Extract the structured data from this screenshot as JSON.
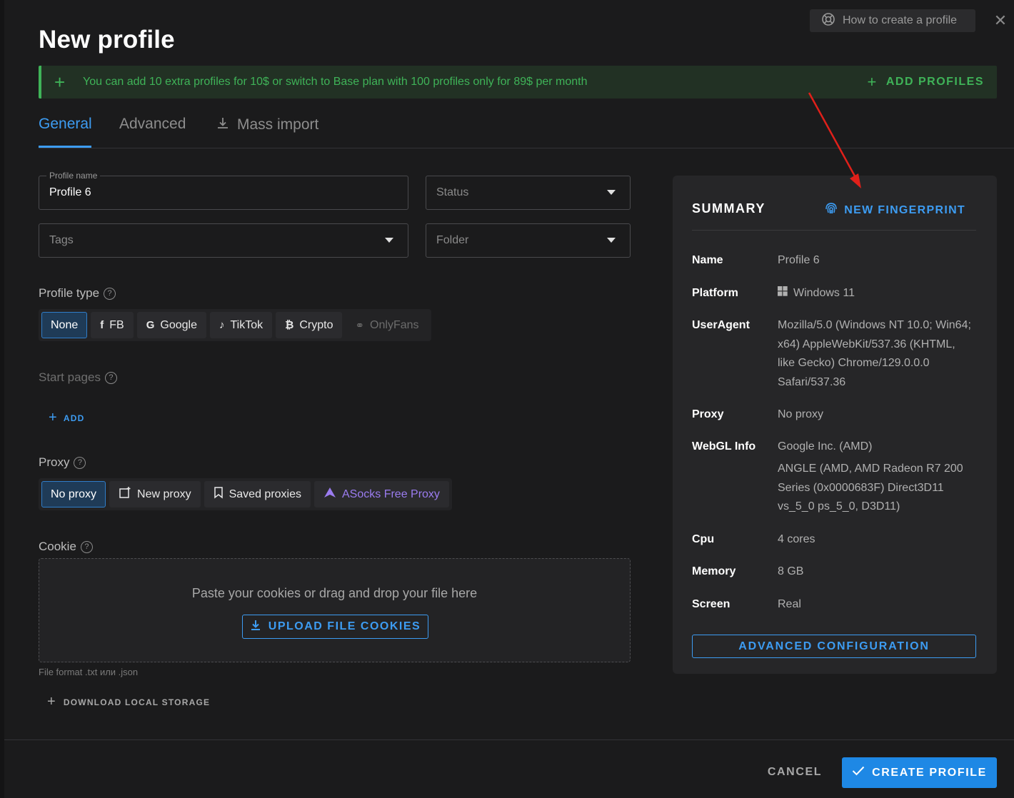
{
  "header": {
    "title": "New profile",
    "howto_label": "How to create a profile"
  },
  "banner": {
    "text": "You can add 10 extra profiles for 10$ or switch to Base plan with 100 profiles only for 89$ per month",
    "action_label": "ADD PROFILES",
    "color": "#3fb358"
  },
  "tabs": [
    {
      "label": "General"
    },
    {
      "label": "Advanced"
    },
    {
      "label": "Mass import"
    }
  ],
  "form": {
    "profile_name": {
      "label": "Profile name",
      "value": "Profile 6"
    },
    "status": {
      "placeholder": "Status"
    },
    "tags": {
      "placeholder": "Tags"
    },
    "folder": {
      "placeholder": "Folder"
    },
    "profile_type": {
      "label": "Profile type",
      "options": [
        "None",
        "FB",
        "Google",
        "TikTok",
        "Crypto",
        "OnlyFans"
      ],
      "selected": "None"
    },
    "start_pages": {
      "label": "Start pages",
      "add_label": "ADD"
    },
    "proxy": {
      "label": "Proxy",
      "options": [
        "No proxy",
        "New proxy",
        "Saved proxies",
        "ASocks Free Proxy"
      ],
      "selected": "No proxy"
    },
    "cookie": {
      "label": "Cookie",
      "hint": "Paste your cookies or drag and drop your file here",
      "upload_label": "UPLOAD FILE COOKIES",
      "format_note": "File format .txt или .json",
      "download_local_label": "DOWNLOAD LOCAL STORAGE"
    }
  },
  "summary": {
    "title": "SUMMARY",
    "fingerprint_label": "NEW FINGERPRINT",
    "rows": [
      {
        "key": "Name",
        "value": "Profile 6"
      },
      {
        "key": "Platform",
        "value": "Windows 11"
      },
      {
        "key": "UserAgent",
        "value": "Mozilla/5.0 (Windows NT 10.0; Win64; x64) AppleWebKit/537.36 (KHTML, like Gecko) Chrome/129.0.0.0 Safari/537.36"
      },
      {
        "key": "Proxy",
        "value": "No proxy"
      },
      {
        "key": "WebGL Info",
        "value": "Google Inc. (AMD)",
        "value2": "ANGLE (AMD, AMD Radeon R7 200 Series (0x0000683F) Direct3D11 vs_5_0 ps_5_0, D3D11)"
      },
      {
        "key": "Cpu",
        "value": "4 cores"
      },
      {
        "key": "Memory",
        "value": "8 GB"
      },
      {
        "key": "Screen",
        "value": "Real"
      }
    ],
    "advanced_label": "ADVANCED CONFIGURATION"
  },
  "footer": {
    "cancel_label": "CANCEL",
    "create_label": "CREATE PROFILE"
  },
  "colors": {
    "accent": "#3d9cf2",
    "primary_button": "#1e88e5",
    "success": "#3fb358",
    "purple": "#9b7cf0",
    "annotation_arrow": "#e0201a"
  }
}
